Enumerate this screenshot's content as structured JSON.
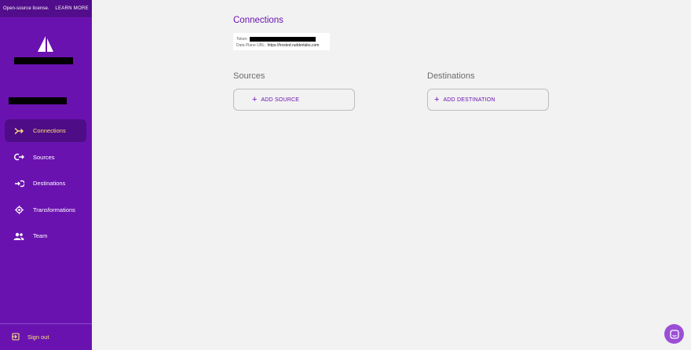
{
  "license_bar": {
    "text": "Open-source license.",
    "learn_more": "LEARN MORE"
  },
  "sidebar": {
    "items": [
      {
        "label": "Connections",
        "icon": "connections-icon",
        "active": true
      },
      {
        "label": "Sources",
        "icon": "sources-icon",
        "active": false
      },
      {
        "label": "Destinations",
        "icon": "destinations-icon",
        "active": false
      },
      {
        "label": "Transformations",
        "icon": "transformations-icon",
        "active": false
      },
      {
        "label": "Team",
        "icon": "team-icon",
        "active": false
      }
    ],
    "signout_label": "Sign out"
  },
  "main": {
    "title": "Connections",
    "token_label": "Token:",
    "data_plane_label": "Data Plane URL:",
    "data_plane_url": "https://hosted.rudderlabs.com",
    "sources_title": "Sources",
    "add_source_label": "ADD SOURCE",
    "destinations_title": "Destinations",
    "add_destination_label": "ADD DESTINATION"
  },
  "colors": {
    "sidebar_bg": "#6a12b0",
    "accent": "#6a12b0",
    "active_text": "#f5e07a",
    "background": "#f2f2f2"
  }
}
